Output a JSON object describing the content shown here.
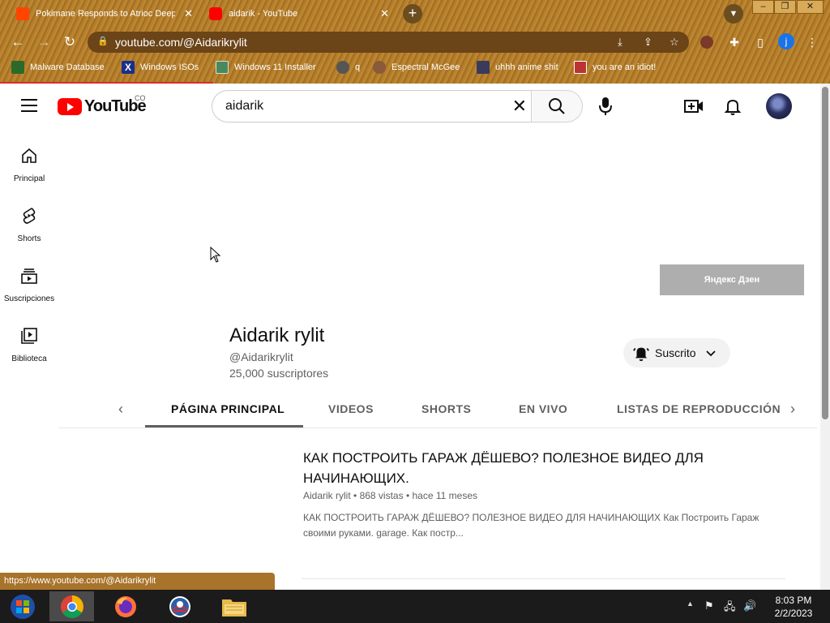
{
  "browser": {
    "tabs": [
      {
        "title": "Pokimane Responds to Atrioc Deepfake",
        "favicon_color": "#ff4500"
      },
      {
        "title": "aidarik - YouTube",
        "favicon_color": "#ff0000"
      }
    ],
    "url": "youtube.com/@Aidarikrylit",
    "bookmarks": [
      "Malware Database",
      "Windows ISOs",
      "Windows 11 Installer",
      "q",
      "Espectral McGee",
      "uhhh anime shit",
      "you are an idiot!"
    ],
    "profile_initial": "j",
    "status_url": "https://www.youtube.com/@Aidarikrylit"
  },
  "youtube": {
    "logo_text": "YouTube",
    "country_code": "CO",
    "search_query": "aidarik",
    "guide": [
      {
        "label": "Principal",
        "icon": "home-icon"
      },
      {
        "label": "Shorts",
        "icon": "shorts-icon"
      },
      {
        "label": "Suscripciones",
        "icon": "subscriptions-icon"
      },
      {
        "label": "Biblioteca",
        "icon": "library-icon"
      }
    ],
    "ad_button": "Яндекс Дзен",
    "channel": {
      "name": "Aidarik rylit",
      "handle": "@Aidarikrylit",
      "subscribers": "25,000 suscriptores",
      "subscribe_state": "Suscrito"
    },
    "tabs": [
      "PÁGINA PRINCIPAL",
      "VIDEOS",
      "SHORTS",
      "EN VIVO",
      "LISTAS DE REPRODUCCIÓN"
    ],
    "active_tab": "PÁGINA PRINCIPAL",
    "featured_video": {
      "title": "КАК ПОСТРОИТЬ ГАРАЖ ДЁШЕВО? ПОЛЕЗНОЕ ВИДЕО ДЛЯ НАЧИНАЮЩИХ.",
      "channel": "Aidarik rylit",
      "views": "868 vistas",
      "age": "hace 11 meses",
      "separator": "•",
      "description": "КАК ПОСТРОИТЬ ГАРАЖ ДЁШЕВО? ПОЛЕЗНОЕ ВИДЕО ДЛЯ НАЧИНАЮЩИХ Как Построить Гараж своими руками. garage. Как постр..."
    }
  },
  "taskbar": {
    "time": "8:03 PM",
    "date": "2/2/2023"
  },
  "colors": {
    "accent_red": "#ff0000",
    "progress_red": "#d93025",
    "text_primary": "#0f0f0f",
    "text_secondary": "#606060",
    "chrome_brown": "#6b4418"
  }
}
